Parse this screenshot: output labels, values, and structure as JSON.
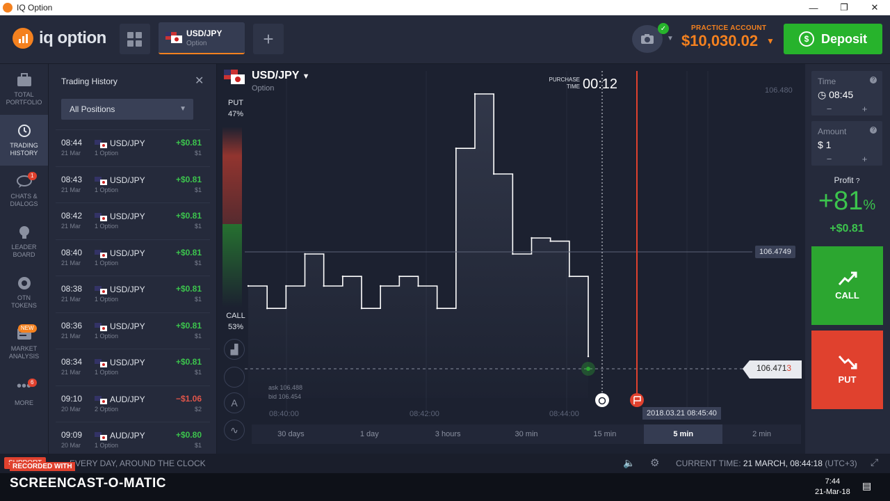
{
  "window": {
    "title": "IQ Option",
    "controls": [
      "—",
      "❐",
      "✕"
    ]
  },
  "header": {
    "brand": "iq option",
    "asset_tab": {
      "name": "USD/JPY",
      "type": "Option"
    },
    "practice_label": "PRACTICE ACCOUNT",
    "balance": "$10,030.02",
    "deposit_label": "Deposit"
  },
  "sidebar": {
    "items": [
      {
        "label1": "TOTAL",
        "label2": "PORTFOLIO",
        "icon": "briefcase-icon"
      },
      {
        "label1": "TRADING",
        "label2": "HISTORY",
        "icon": "history-icon"
      },
      {
        "label1": "CHATS &",
        "label2": "DIALOGS",
        "icon": "chat-icon",
        "badge": "1"
      },
      {
        "label1": "LEADER",
        "label2": "BOARD",
        "icon": "trophy-icon"
      },
      {
        "label1": "OTN",
        "label2": "TOKENS",
        "icon": "token-icon"
      },
      {
        "label1": "MARKET",
        "label2": "ANALYSIS",
        "icon": "analysis-icon",
        "badge": "NEW"
      },
      {
        "label1": "MORE",
        "label2": "",
        "icon": "more-icon",
        "badge": "6"
      }
    ]
  },
  "history": {
    "title": "Trading History",
    "filter": "All Positions",
    "rows": [
      {
        "time": "08:44",
        "date": "21 Mar",
        "asset": "USD/JPY",
        "options": "1 Option",
        "profit": "+$0.81",
        "amount": "$1",
        "positive": true
      },
      {
        "time": "08:43",
        "date": "21 Mar",
        "asset": "USD/JPY",
        "options": "1 Option",
        "profit": "+$0.81",
        "amount": "$1",
        "positive": true
      },
      {
        "time": "08:42",
        "date": "21 Mar",
        "asset": "USD/JPY",
        "options": "1 Option",
        "profit": "+$0.81",
        "amount": "$1",
        "positive": true
      },
      {
        "time": "08:40",
        "date": "21 Mar",
        "asset": "USD/JPY",
        "options": "1 Option",
        "profit": "+$0.81",
        "amount": "$1",
        "positive": true
      },
      {
        "time": "08:38",
        "date": "21 Mar",
        "asset": "USD/JPY",
        "options": "1 Option",
        "profit": "+$0.81",
        "amount": "$1",
        "positive": true
      },
      {
        "time": "08:36",
        "date": "21 Mar",
        "asset": "USD/JPY",
        "options": "1 Option",
        "profit": "+$0.81",
        "amount": "$1",
        "positive": true
      },
      {
        "time": "08:34",
        "date": "21 Mar",
        "asset": "USD/JPY",
        "options": "1 Option",
        "profit": "+$0.81",
        "amount": "$1",
        "positive": true
      },
      {
        "time": "09:10",
        "date": "20 Mar",
        "asset": "AUD/JPY",
        "options": "2 Option",
        "profit": "−$1.06",
        "amount": "$2",
        "positive": false
      },
      {
        "time": "09:09",
        "date": "20 Mar",
        "asset": "AUD/JPY",
        "options": "1 Option",
        "profit": "+$0.80",
        "amount": "$1",
        "positive": true
      }
    ]
  },
  "chart": {
    "asset": "USD/JPY",
    "asset_type": "Option",
    "purchase_label_1": "PURCHASE",
    "purchase_label_2": "TIME",
    "purchase_time": "00:12",
    "put_label": "PUT",
    "put_pct": "47%",
    "call_label": "CALL",
    "call_pct": "53%",
    "top_price": "106.480",
    "hover_price": "106.4749",
    "current_price": "106.471",
    "current_price_last": "3",
    "ask": "ask 106.488",
    "bid": "bid 106.454",
    "date_tip": "2018.03.21 08:45:40",
    "time_labels": [
      "08:40:00",
      "08:42:00",
      "08:44:00"
    ],
    "periods": [
      "30 days",
      "1 day",
      "3 hours",
      "30 min",
      "15 min",
      "5 min",
      "2 min"
    ],
    "selected_period": "5 min"
  },
  "chart_data": {
    "type": "line",
    "title": "",
    "xlabel": "",
    "ylabel": "",
    "x": [
      "08:39:45",
      "08:40:00",
      "08:40:15",
      "08:40:30",
      "08:40:45",
      "08:41:00",
      "08:41:15",
      "08:41:30",
      "08:41:45",
      "08:42:00",
      "08:42:15",
      "08:42:30",
      "08:42:45",
      "08:43:00",
      "08:43:15",
      "08:43:30",
      "08:43:45",
      "08:44:00",
      "08:44:10"
    ],
    "values": [
      106.4735,
      106.4728,
      106.4735,
      106.4745,
      106.4735,
      106.4738,
      106.4728,
      106.4735,
      106.4738,
      106.4735,
      106.4728,
      106.4778,
      106.4795,
      106.477,
      106.4745,
      106.475,
      106.4749,
      106.4738,
      106.4713
    ],
    "ylim": [
      106.47,
      106.48
    ],
    "grid": true
  },
  "trade": {
    "time_label": "Time",
    "time_value": "08:45",
    "amount_label": "Amount",
    "amount_value": "$  1",
    "minus": "−",
    "plus": "+",
    "profit_label": "Profit",
    "profit_pct": "+81",
    "profit_pct_sign": "%",
    "profit_amount": "+$0.81",
    "call_label": "CALL",
    "put_label": "PUT"
  },
  "footer": {
    "support": "SUPPORT",
    "always": "EVERY DAY, AROUND THE CLOCK",
    "current_time_label": "CURRENT TIME:",
    "current_time_value": "21 MARCH, 08:44:18",
    "timezone": "(UTC+3)"
  },
  "watermark": {
    "recorded": "RECORDED WITH",
    "brand": "SCREENCAST-O-MATIC"
  },
  "taskbar": {
    "time": "7:44",
    "date": "21-Mar-18"
  },
  "colors": {
    "accent": "#f4811f",
    "green": "#2ca630",
    "red": "#e0412e",
    "bg": "#1c2130"
  }
}
